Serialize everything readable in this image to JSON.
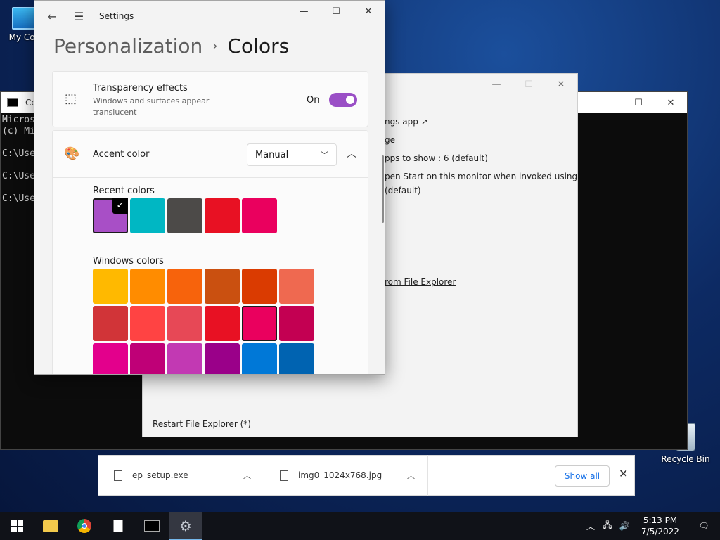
{
  "desktop": {
    "icons": [
      {
        "label": "My Com"
      },
      {
        "label": "Recycle Bin"
      }
    ]
  },
  "cmd": {
    "title": "Co",
    "lines": [
      "Micros",
      "(c) Mi",
      "",
      "C:\\Use",
      "",
      "C:\\Use",
      "",
      "C:\\Use"
    ]
  },
  "ep_window": {
    "lines": [
      "ngs app ↗",
      "ge",
      "pps to show : 6 (default)",
      "pen Start on this monitor when invoked using",
      "(default)",
      "rom File Explorer"
    ],
    "restart_link": "Restart File Explorer (*)"
  },
  "settings": {
    "app_title": "Settings",
    "breadcrumb_parent": "Personalization",
    "breadcrumb_sep": "›",
    "breadcrumb_current": "Colors",
    "transparency": {
      "title": "Transparency effects",
      "subtitle": "Windows and surfaces appear translucent",
      "state": "On",
      "enabled": true
    },
    "accent": {
      "title": "Accent color",
      "mode": "Manual"
    },
    "recent_label": "Recent colors",
    "recent_colors": [
      "#a84fc6",
      "#00b7c3",
      "#4c4a48",
      "#e81123",
      "#ea005e"
    ],
    "selected_recent": 0,
    "windows_label": "Windows colors",
    "windows_colors": [
      "#ffb900",
      "#ff8c00",
      "#f7630c",
      "#ca5010",
      "#da3b01",
      "#ef6950",
      "#d13438",
      "#ff4343",
      "#e74856",
      "#e81123",
      "#ea005e",
      "#c30052",
      "#e3008c",
      "#bf0077",
      "#c239b3",
      "#9a0089",
      "#0078d7",
      "#0063b1"
    ],
    "hovered_windows": 10
  },
  "downloads": {
    "items": [
      {
        "name": "ep_setup.exe"
      },
      {
        "name": "img0_1024x768.jpg"
      }
    ],
    "show_all": "Show all"
  },
  "taskbar": {
    "time": "5:13 PM",
    "date": "7/5/2022"
  }
}
